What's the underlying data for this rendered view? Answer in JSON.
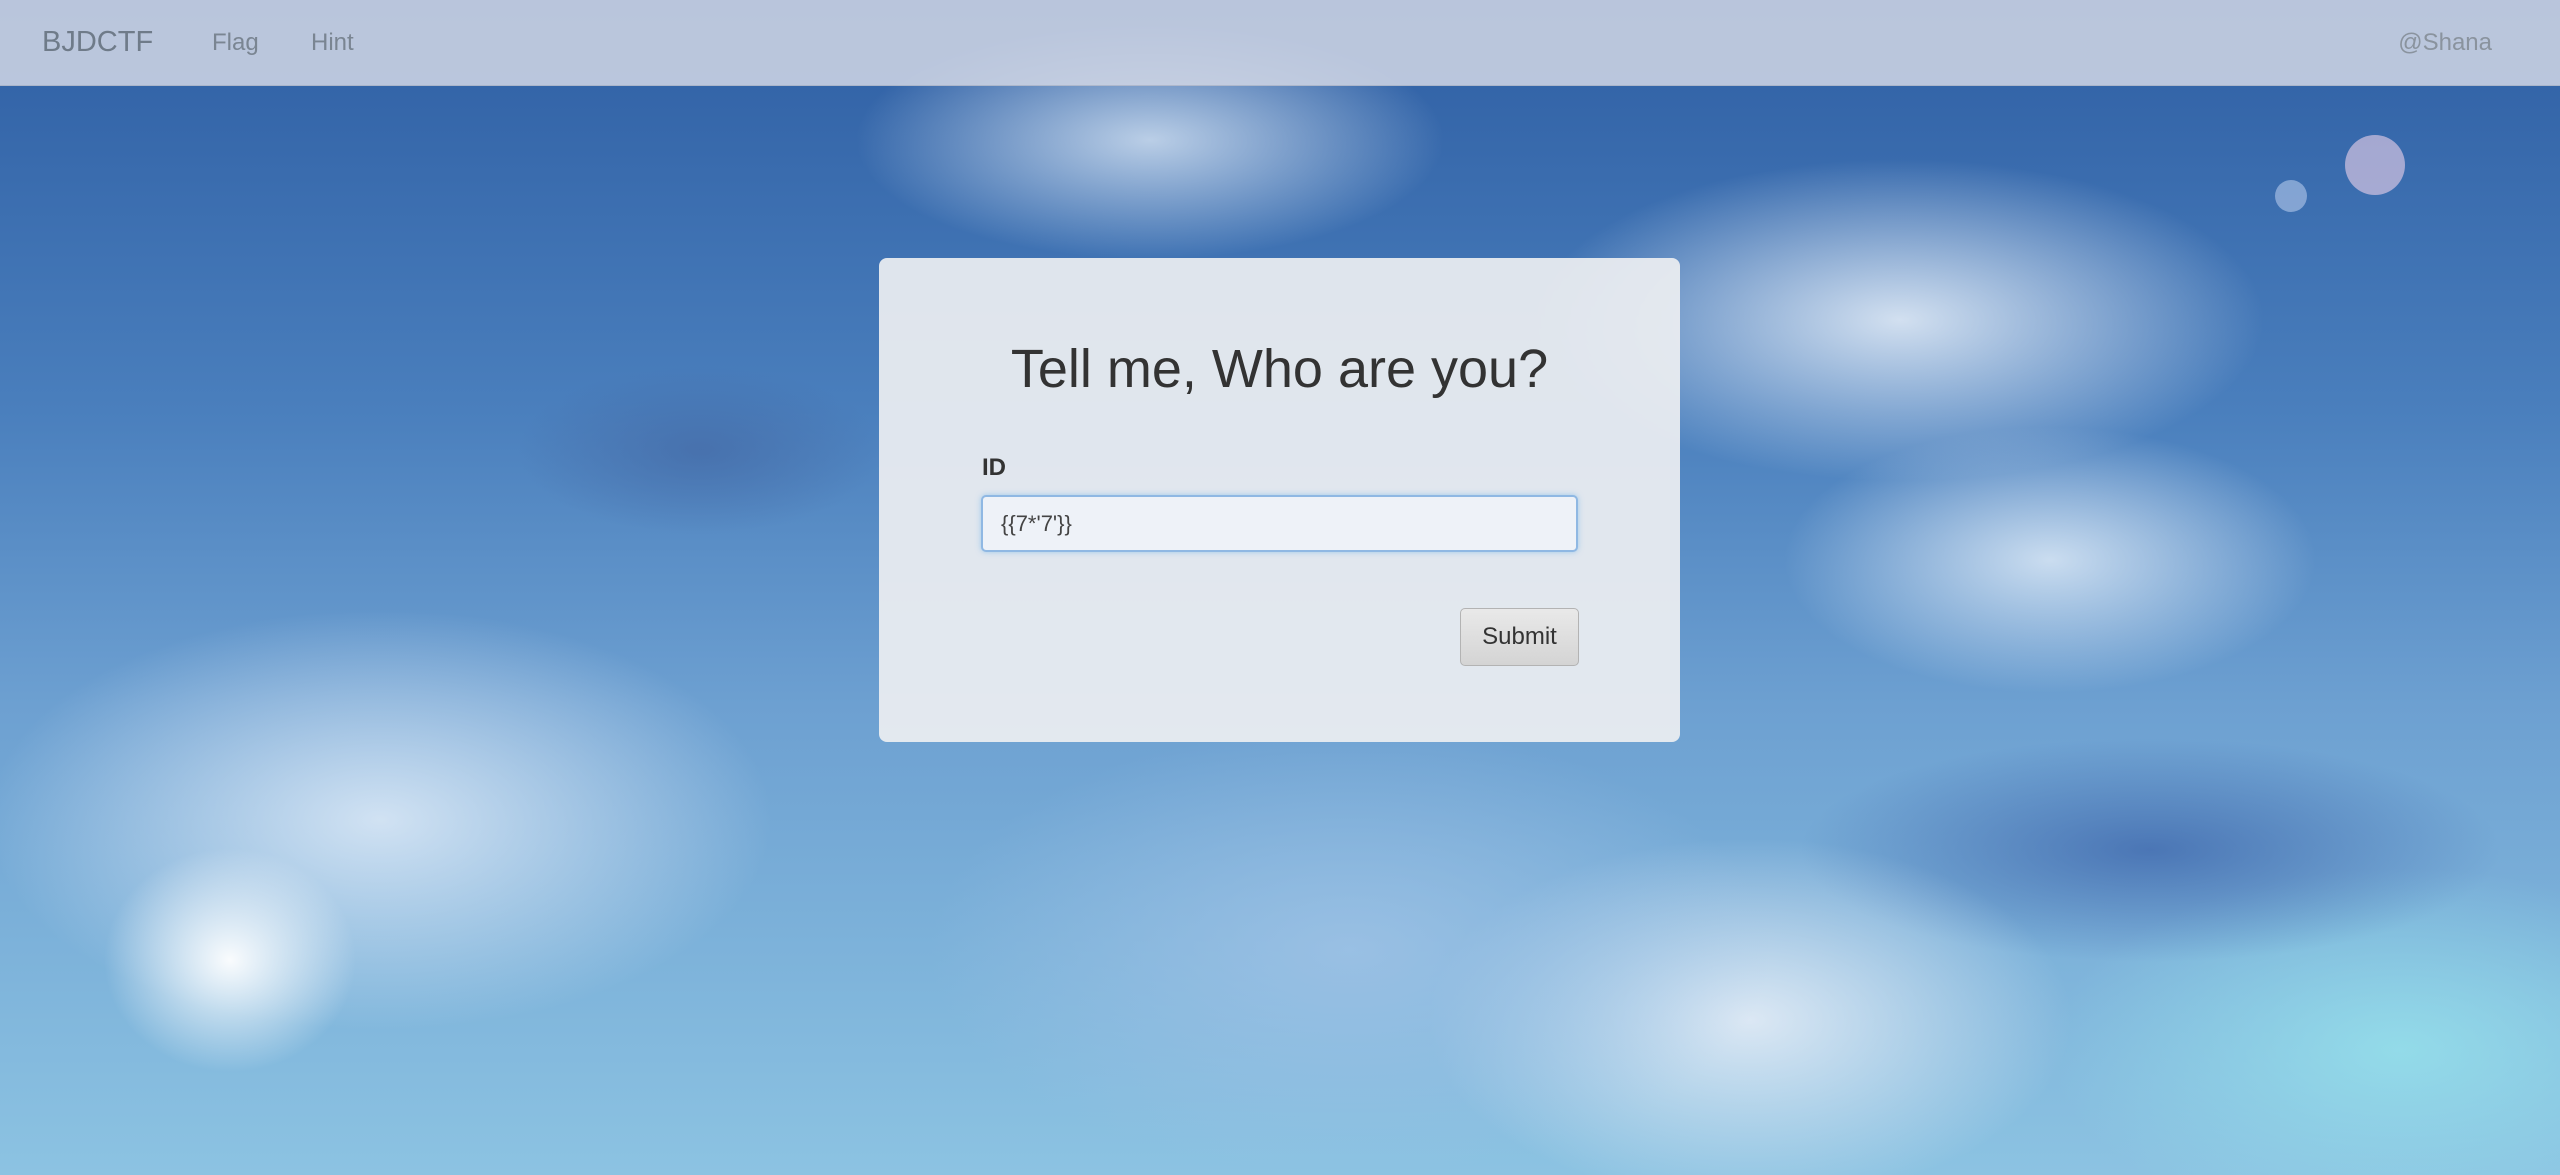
{
  "navbar": {
    "brand": "BJDCTF",
    "links": [
      {
        "label": "Flag"
      },
      {
        "label": "Hint"
      }
    ],
    "user": "@Shana"
  },
  "form": {
    "title": "Tell me, Who are you?",
    "id_label": "ID",
    "id_value": "{{7*'7'}}",
    "submit_label": "Submit"
  },
  "colors": {
    "navbar_bg": "#cdd4e4",
    "card_bg": "#eceef1",
    "input_focus_border": "#8fb8e3",
    "text_dark": "#333333"
  }
}
